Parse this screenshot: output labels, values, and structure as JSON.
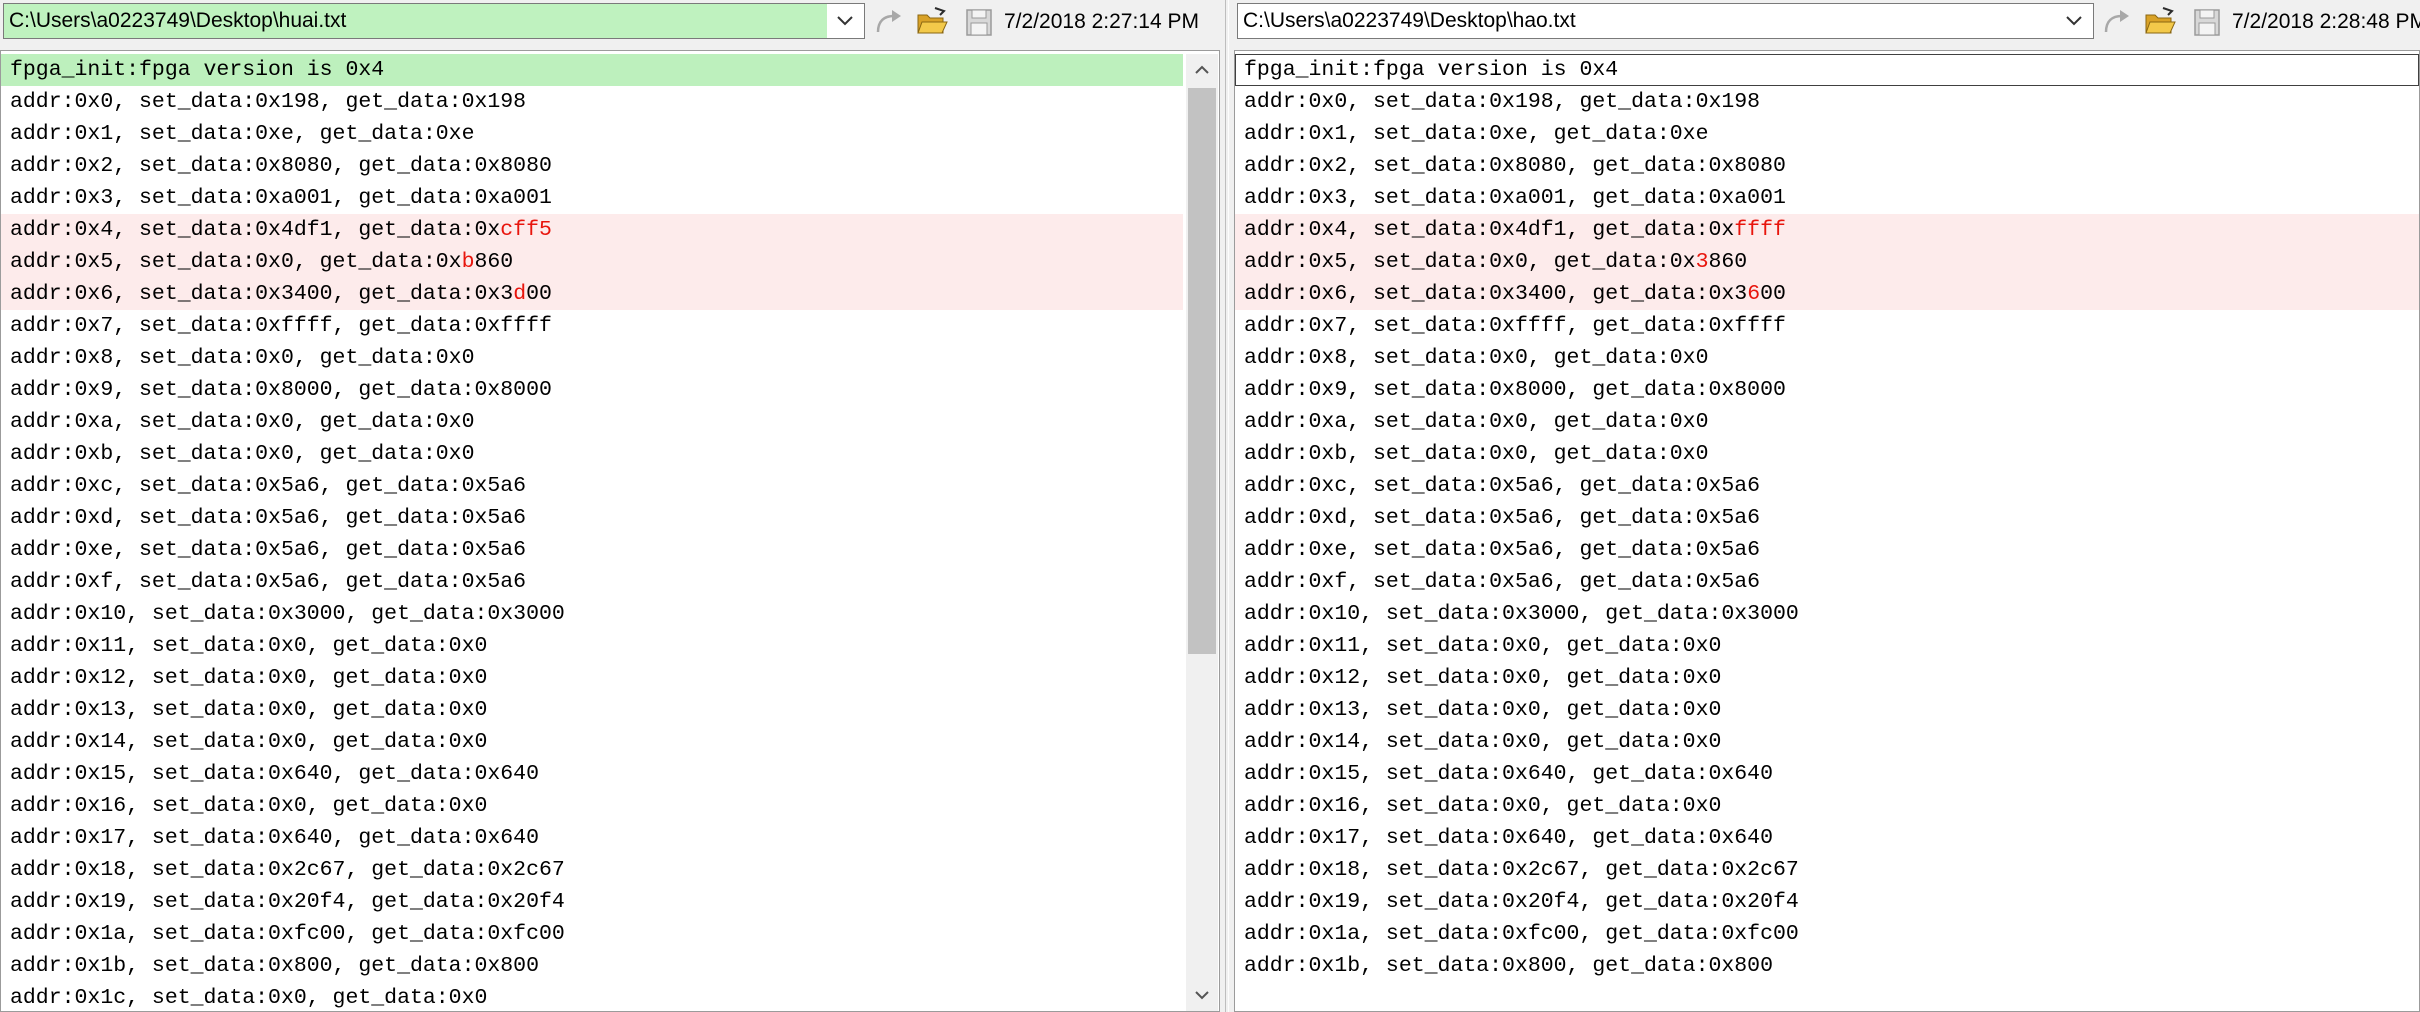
{
  "left": {
    "path": "C:\\Users\\a0223749\\Desktop\\huai.txt",
    "timestamp": "7/2/2018 2:27:14 PM",
    "lines": [
      [
        {
          "t": "fpga_init:fpga version is 0x4"
        }
      ],
      [
        {
          "t": "addr:0x0, set_data:0x198, get_data:0x198"
        }
      ],
      [
        {
          "t": "addr:0x1, set_data:0xe, get_data:0xe"
        }
      ],
      [
        {
          "t": "addr:0x2, set_data:0x8080, get_data:0x8080"
        }
      ],
      [
        {
          "t": "addr:0x3, set_data:0xa001, get_data:0xa001"
        }
      ],
      [
        {
          "t": "addr:0x4, set_data:0x4df1, get_data:0x"
        },
        {
          "t": "cff5",
          "d": true
        }
      ],
      [
        {
          "t": "addr:0x5, set_data:0x0, get_data:0x"
        },
        {
          "t": "b",
          "d": true
        },
        {
          "t": "860"
        }
      ],
      [
        {
          "t": "addr:0x6, set_data:0x3400, get_data:0x3"
        },
        {
          "t": "d",
          "d": true
        },
        {
          "t": "00"
        }
      ],
      [
        {
          "t": "addr:0x7, set_data:0xffff, get_data:0xffff"
        }
      ],
      [
        {
          "t": "addr:0x8, set_data:0x0, get_data:0x0"
        }
      ],
      [
        {
          "t": "addr:0x9, set_data:0x8000, get_data:0x8000"
        }
      ],
      [
        {
          "t": "addr:0xa, set_data:0x0, get_data:0x0"
        }
      ],
      [
        {
          "t": "addr:0xb, set_data:0x0, get_data:0x0"
        }
      ],
      [
        {
          "t": "addr:0xc, set_data:0x5a6, get_data:0x5a6"
        }
      ],
      [
        {
          "t": "addr:0xd, set_data:0x5a6, get_data:0x5a6"
        }
      ],
      [
        {
          "t": "addr:0xe, set_data:0x5a6, get_data:0x5a6"
        }
      ],
      [
        {
          "t": "addr:0xf, set_data:0x5a6, get_data:0x5a6"
        }
      ],
      [
        {
          "t": "addr:0x10, set_data:0x3000, get_data:0x3000"
        }
      ],
      [
        {
          "t": "addr:0x11, set_data:0x0, get_data:0x0"
        }
      ],
      [
        {
          "t": "addr:0x12, set_data:0x0, get_data:0x0"
        }
      ],
      [
        {
          "t": "addr:0x13, set_data:0x0, get_data:0x0"
        }
      ],
      [
        {
          "t": "addr:0x14, set_data:0x0, get_data:0x0"
        }
      ],
      [
        {
          "t": "addr:0x15, set_data:0x640, get_data:0x640"
        }
      ],
      [
        {
          "t": "addr:0x16, set_data:0x0, get_data:0x0"
        }
      ],
      [
        {
          "t": "addr:0x17, set_data:0x640, get_data:0x640"
        }
      ],
      [
        {
          "t": "addr:0x18, set_data:0x2c67, get_data:0x2c67"
        }
      ],
      [
        {
          "t": "addr:0x19, set_data:0x20f4, get_data:0x20f4"
        }
      ],
      [
        {
          "t": "addr:0x1a, set_data:0xfc00, get_data:0xfc00"
        }
      ],
      [
        {
          "t": "addr:0x1b, set_data:0x800, get_data:0x800"
        }
      ],
      [
        {
          "t": "addr:0x1c, set_data:0x0, get_data:0x0"
        }
      ]
    ]
  },
  "right": {
    "path": "C:\\Users\\a0223749\\Desktop\\hao.txt",
    "timestamp": "7/2/2018 2:28:48 PM",
    "lines": [
      [
        {
          "t": "fpga_init:fpga version is 0x4"
        }
      ],
      [
        {
          "t": "addr:0x0, set_data:0x198, get_data:0x198"
        }
      ],
      [
        {
          "t": "addr:0x1, set_data:0xe, get_data:0xe"
        }
      ],
      [
        {
          "t": "addr:0x2, set_data:0x8080, get_data:0x8080"
        }
      ],
      [
        {
          "t": "addr:0x3, set_data:0xa001, get_data:0xa001"
        }
      ],
      [
        {
          "t": "addr:0x4, set_data:0x4df1, get_data:0x"
        },
        {
          "t": "ffff",
          "d": true
        }
      ],
      [
        {
          "t": "addr:0x5, set_data:0x0, get_data:0x"
        },
        {
          "t": "3",
          "d": true
        },
        {
          "t": "860"
        }
      ],
      [
        {
          "t": "addr:0x6, set_data:0x3400, get_data:0x3"
        },
        {
          "t": "6",
          "d": true
        },
        {
          "t": "00"
        }
      ],
      [
        {
          "t": "addr:0x7, set_data:0xffff, get_data:0xffff"
        }
      ],
      [
        {
          "t": "addr:0x8, set_data:0x0, get_data:0x0"
        }
      ],
      [
        {
          "t": "addr:0x9, set_data:0x8000, get_data:0x8000"
        }
      ],
      [
        {
          "t": "addr:0xa, set_data:0x0, get_data:0x0"
        }
      ],
      [
        {
          "t": "addr:0xb, set_data:0x0, get_data:0x0"
        }
      ],
      [
        {
          "t": "addr:0xc, set_data:0x5a6, get_data:0x5a6"
        }
      ],
      [
        {
          "t": "addr:0xd, set_data:0x5a6, get_data:0x5a6"
        }
      ],
      [
        {
          "t": "addr:0xe, set_data:0x5a6, get_data:0x5a6"
        }
      ],
      [
        {
          "t": "addr:0xf, set_data:0x5a6, get_data:0x5a6"
        }
      ],
      [
        {
          "t": "addr:0x10, set_data:0x3000, get_data:0x3000"
        }
      ],
      [
        {
          "t": "addr:0x11, set_data:0x0, get_data:0x0"
        }
      ],
      [
        {
          "t": "addr:0x12, set_data:0x0, get_data:0x0"
        }
      ],
      [
        {
          "t": "addr:0x13, set_data:0x0, get_data:0x0"
        }
      ],
      [
        {
          "t": "addr:0x14, set_data:0x0, get_data:0x0"
        }
      ],
      [
        {
          "t": "addr:0x15, set_data:0x640, get_data:0x640"
        }
      ],
      [
        {
          "t": "addr:0x16, set_data:0x0, get_data:0x0"
        }
      ],
      [
        {
          "t": "addr:0x17, set_data:0x640, get_data:0x640"
        }
      ],
      [
        {
          "t": "addr:0x18, set_data:0x2c67, get_data:0x2c67"
        }
      ],
      [
        {
          "t": "addr:0x19, set_data:0x20f4, get_data:0x20f4"
        }
      ],
      [
        {
          "t": "addr:0x1a, set_data:0xfc00, get_data:0xfc00"
        }
      ],
      [
        {
          "t": "addr:0x1b, set_data:0x800, get_data:0x800"
        }
      ]
    ]
  },
  "colors": {
    "current_line_left": "#bdf0bd",
    "diff_line_bg": "#fdebeb",
    "diff_char": "#e8150d"
  },
  "icons": [
    "chevron-down-icon",
    "reload-icon",
    "open-folder-icon",
    "save-icon",
    "scroll-up-icon",
    "scroll-down-icon"
  ]
}
